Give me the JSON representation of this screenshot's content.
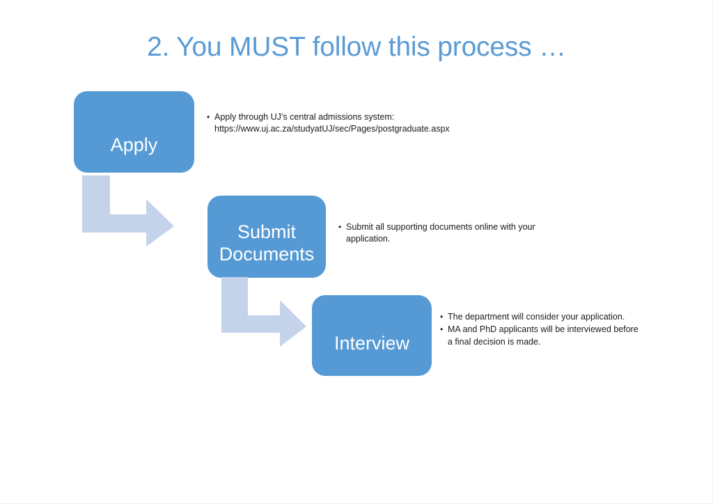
{
  "slide": {
    "title": "2. You MUST follow this process …",
    "title_color": "#5B9BD5",
    "background_color": "#FFFFFF"
  },
  "theme": {
    "box_fill": "#559AD4",
    "box_text_color": "#FFFFFF",
    "arrow_fill": "#C5D3EA",
    "body_text_color": "#1A1A1A"
  },
  "steps": [
    {
      "id": "apply",
      "label": "Apply",
      "bullets": [
        "Apply through UJ’s central admissions system: https://www.uj.ac.za/studyatUJ/sec/Pages/postgraduate.aspx"
      ]
    },
    {
      "id": "submit-documents",
      "label": "Submit\nDocuments",
      "label_line1": "Submit",
      "label_line2": "Documents",
      "bullets": [
        "Submit all supporting documents online with your application."
      ]
    },
    {
      "id": "interview",
      "label": "Interview",
      "bullets": [
        "The department will consider your application.",
        "MA and PhD applicants will be interviewed before a final decision is made."
      ]
    }
  ],
  "connectors": [
    {
      "id": "arrow-apply-to-submit",
      "from": "apply",
      "to": "submit-documents",
      "shape": "elbow-down-right-arrow"
    },
    {
      "id": "arrow-submit-to-interview",
      "from": "submit-documents",
      "to": "interview",
      "shape": "elbow-down-right-arrow"
    }
  ]
}
